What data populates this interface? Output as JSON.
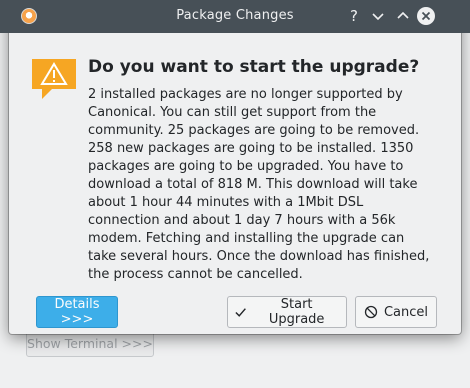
{
  "window": {
    "title": "Package Changes",
    "help_icon": "question-mark-icon",
    "minimize_icon": "chevron-down-icon",
    "maximize_icon": "chevron-up-icon",
    "close_icon": "close-icon"
  },
  "dialog": {
    "heading": "Do you want to start the upgrade?",
    "message": "2 installed packages are no longer supported by Canonical. You can still get support from the community. 25 packages are going to be removed. 258 new packages are going to be installed. 1350 packages are going to be upgraded. You have to download a total of 818 M. This download will take about 1 hour 44 minutes with a 1Mbit DSL connection and about 1 day 7 hours with a 56k modem. Fetching and installing the upgrade can take several hours. Once the download has finished, the process cannot be cancelled.",
    "icon": "warning-icon"
  },
  "buttons": {
    "details_label": "Details >>>",
    "start_label": "Start Upgrade",
    "cancel_label": "Cancel"
  },
  "background": {
    "show_terminal_label": "Show Terminal >>>"
  },
  "colors": {
    "titlebar": "#475057",
    "accent": "#3daee9",
    "warning": "#f6a623"
  }
}
